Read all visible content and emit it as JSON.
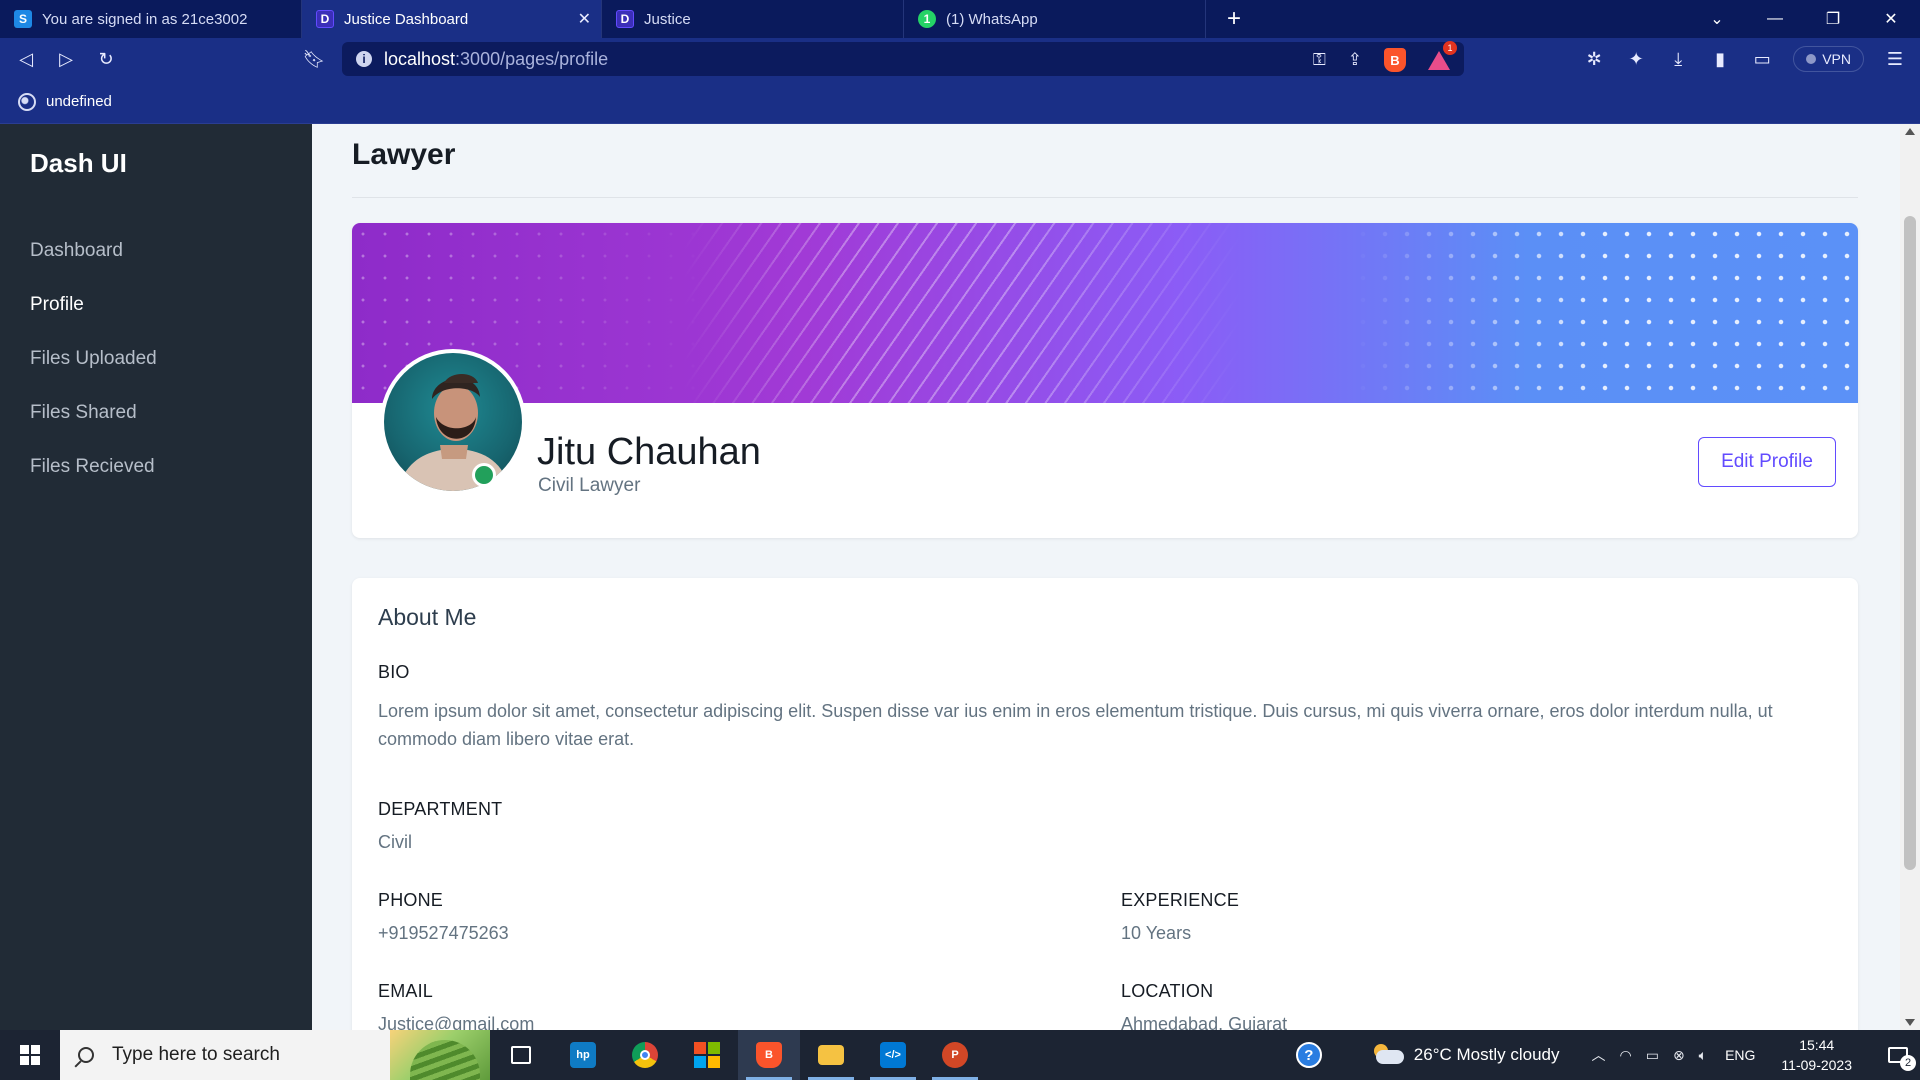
{
  "browser": {
    "tabs": [
      {
        "label": "You are signed in as 21ce3002",
        "icon": "s-icon",
        "color": "#1e88e5",
        "glyph": "S"
      },
      {
        "label": "Justice Dashboard",
        "icon": "d-icon",
        "color": "#624bff",
        "glyph": "D"
      },
      {
        "label": "Justice",
        "icon": "d-icon",
        "color": "#624bff",
        "glyph": "D"
      },
      {
        "label": "(1) WhatsApp",
        "icon": "whatsapp-icon",
        "color": "#25d366",
        "glyph": "1"
      }
    ],
    "active_tab_index": 1,
    "address": {
      "host": "localhost",
      "path": ":3000/pages/profile"
    },
    "vpn_label": "VPN",
    "brave_rewards_badge": "1",
    "bookmark": {
      "label": "undefined"
    }
  },
  "sidebar": {
    "brand": "Dash UI",
    "items": [
      {
        "label": "Dashboard",
        "active": false
      },
      {
        "label": "Profile",
        "active": true
      },
      {
        "label": "Files Uploaded",
        "active": false
      },
      {
        "label": "Files Shared",
        "active": false
      },
      {
        "label": "Files Recieved",
        "active": false
      }
    ]
  },
  "page": {
    "title": "Lawyer",
    "profile": {
      "name": "Jitu Chauhan",
      "role": "Civil Lawyer",
      "status": "online",
      "edit_label": "Edit Profile"
    },
    "about": {
      "title": "About Me",
      "bio_label": "BIO",
      "bio": "Lorem ipsum dolor sit amet, consectetur adipiscing elit. Suspen disse var ius enim in eros elementum tristique. Duis cursus, mi quis viverra ornare, eros dolor interdum nulla, ut commodo diam libero vitae erat.",
      "department_label": "DEPARTMENT",
      "department": "Civil",
      "phone_label": "PHONE",
      "phone": "+919527475263",
      "experience_label": "EXPERIENCE",
      "experience": "10 Years",
      "email_label": "EMAIL",
      "email": "Justice@gmail.com",
      "location_label": "LOCATION",
      "location": "Ahmedabad, Gujarat"
    }
  },
  "taskbar": {
    "search_placeholder": "Type here to search",
    "weather": "26°C  Mostly cloudy",
    "language": "ENG",
    "time": "15:44",
    "date": "11-09-2023",
    "notification_count": "2",
    "apps": [
      "task-view",
      "myhp",
      "chrome",
      "microsoft-store",
      "brave",
      "file-explorer",
      "vscode",
      "powerpoint"
    ]
  },
  "colors": {
    "accent": "#624bff",
    "sidebar_bg": "#212b36",
    "online": "#22a05b"
  }
}
